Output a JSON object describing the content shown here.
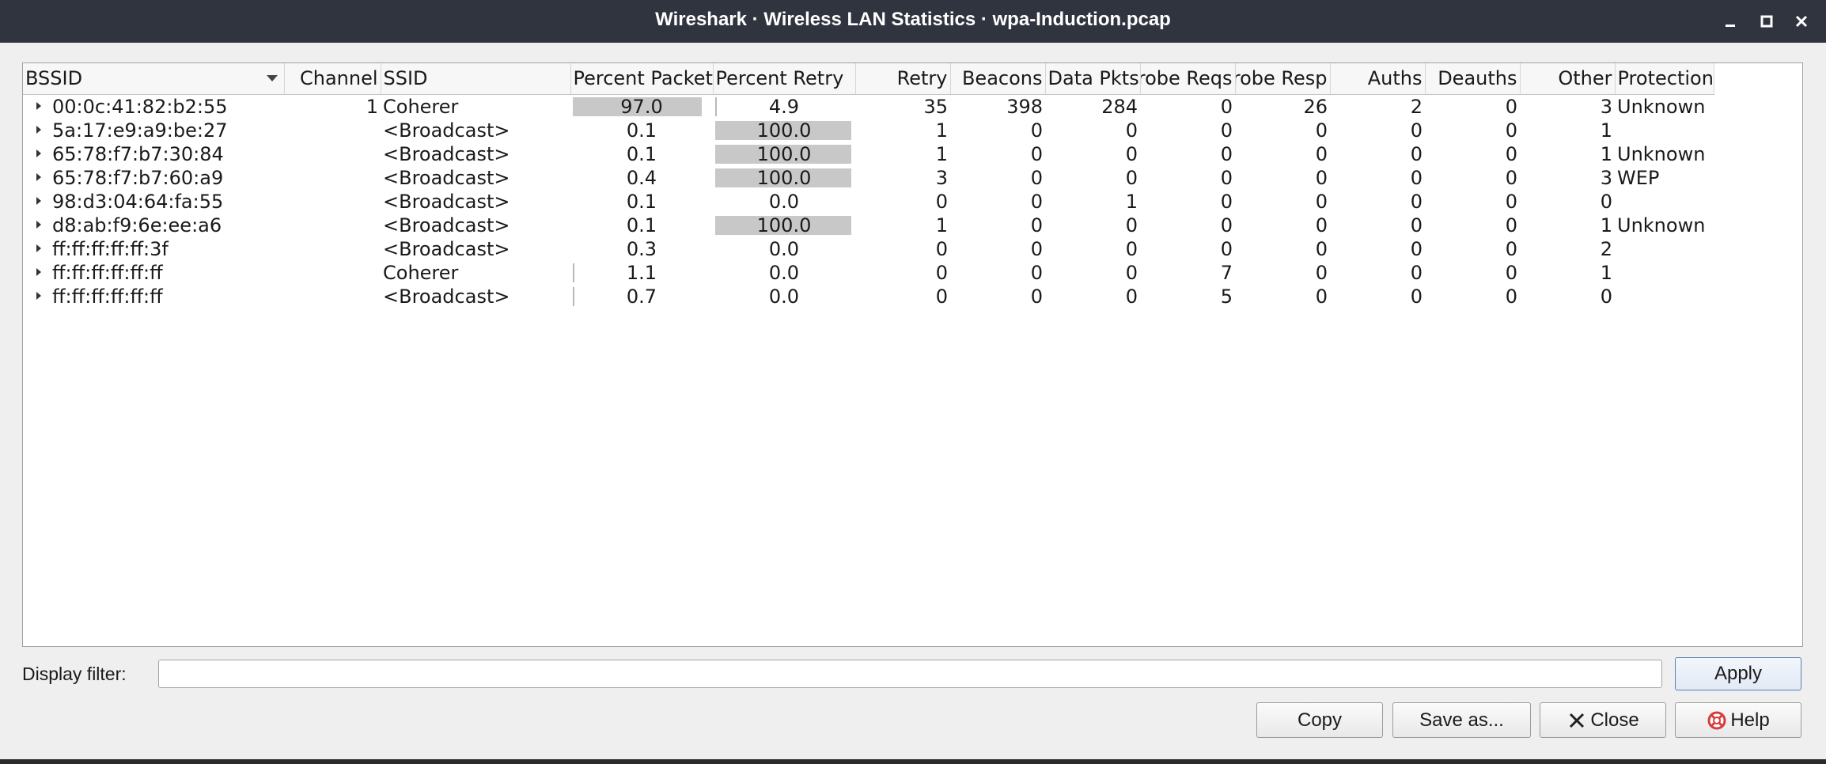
{
  "window": {
    "title": "Wireshark · Wireless LAN Statistics · wpa-Induction.pcap"
  },
  "table": {
    "columns": [
      "BSSID",
      "Channel",
      "SSID",
      "Percent Packets",
      "Percent Retry",
      "Retry",
      "Beacons",
      "Data Pkts",
      "Probe Reqs",
      "Probe Resp",
      "Auths",
      "Deauths",
      "Other",
      "Protection"
    ],
    "rows": [
      {
        "bssid": "00:0c:41:82:b2:55",
        "channel": "1",
        "ssid": "Coherer",
        "pct_packets": "97.0",
        "pct_retry": "4.9",
        "retry": "35",
        "beacons": "398",
        "data_pkts": "284",
        "probe_reqs": "0",
        "probe_resp": "26",
        "auths": "2",
        "deauths": "0",
        "other": "3",
        "protection": "Unknown"
      },
      {
        "bssid": "5a:17:e9:a9:be:27",
        "channel": "",
        "ssid": "<Broadcast>",
        "pct_packets": "0.1",
        "pct_retry": "100.0",
        "retry": "1",
        "beacons": "0",
        "data_pkts": "0",
        "probe_reqs": "0",
        "probe_resp": "0",
        "auths": "0",
        "deauths": "0",
        "other": "1",
        "protection": ""
      },
      {
        "bssid": "65:78:f7:b7:30:84",
        "channel": "",
        "ssid": "<Broadcast>",
        "pct_packets": "0.1",
        "pct_retry": "100.0",
        "retry": "1",
        "beacons": "0",
        "data_pkts": "0",
        "probe_reqs": "0",
        "probe_resp": "0",
        "auths": "0",
        "deauths": "0",
        "other": "1",
        "protection": "Unknown"
      },
      {
        "bssid": "65:78:f7:b7:60:a9",
        "channel": "",
        "ssid": "<Broadcast>",
        "pct_packets": "0.4",
        "pct_retry": "100.0",
        "retry": "3",
        "beacons": "0",
        "data_pkts": "0",
        "probe_reqs": "0",
        "probe_resp": "0",
        "auths": "0",
        "deauths": "0",
        "other": "3",
        "protection": "WEP"
      },
      {
        "bssid": "98:d3:04:64:fa:55",
        "channel": "",
        "ssid": "<Broadcast>",
        "pct_packets": "0.1",
        "pct_retry": "0.0",
        "retry": "0",
        "beacons": "0",
        "data_pkts": "1",
        "probe_reqs": "0",
        "probe_resp": "0",
        "auths": "0",
        "deauths": "0",
        "other": "0",
        "protection": ""
      },
      {
        "bssid": "d8:ab:f9:6e:ee:a6",
        "channel": "",
        "ssid": "<Broadcast>",
        "pct_packets": "0.1",
        "pct_retry": "100.0",
        "retry": "1",
        "beacons": "0",
        "data_pkts": "0",
        "probe_reqs": "0",
        "probe_resp": "0",
        "auths": "0",
        "deauths": "0",
        "other": "1",
        "protection": "Unknown"
      },
      {
        "bssid": "ff:ff:ff:ff:ff:3f",
        "channel": "",
        "ssid": "<Broadcast>",
        "pct_packets": "0.3",
        "pct_retry": "0.0",
        "retry": "0",
        "beacons": "0",
        "data_pkts": "0",
        "probe_reqs": "0",
        "probe_resp": "0",
        "auths": "0",
        "deauths": "0",
        "other": "2",
        "protection": ""
      },
      {
        "bssid": "ff:ff:ff:ff:ff:ff",
        "channel": "",
        "ssid": "Coherer",
        "pct_packets": "1.1",
        "pct_retry": "0.0",
        "retry": "0",
        "beacons": "0",
        "data_pkts": "0",
        "probe_reqs": "7",
        "probe_resp": "0",
        "auths": "0",
        "deauths": "0",
        "other": "1",
        "protection": ""
      },
      {
        "bssid": "ff:ff:ff:ff:ff:ff",
        "channel": "",
        "ssid": "<Broadcast>",
        "pct_packets": "0.7",
        "pct_retry": "0.0",
        "retry": "0",
        "beacons": "0",
        "data_pkts": "0",
        "probe_reqs": "5",
        "probe_resp": "0",
        "auths": "0",
        "deauths": "0",
        "other": "0",
        "protection": ""
      }
    ]
  },
  "filter": {
    "label": "Display filter:",
    "value": "",
    "apply_label": "Apply"
  },
  "buttons": {
    "copy": "Copy",
    "save_as": "Save as...",
    "close": "Close",
    "help": "Help"
  },
  "colors": {
    "titlebar": "#2f343f",
    "bar_fill": "#c8c8c8",
    "dialog_bg": "#efefef"
  }
}
